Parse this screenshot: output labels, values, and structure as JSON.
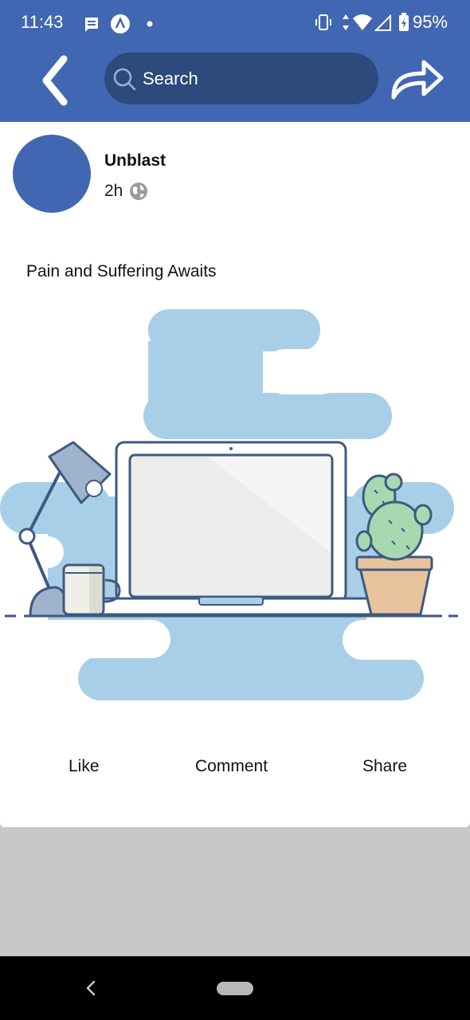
{
  "status_bar": {
    "time": "11:43",
    "battery": "95%",
    "icons": [
      "message-icon",
      "app-icon",
      "dot-icon",
      "vibrate-icon",
      "data-arrows-icon",
      "wifi-icon",
      "signal-icon",
      "battery-icon"
    ]
  },
  "toolbar": {
    "search_placeholder": "Search",
    "back_icon": "chevron-left-icon",
    "share_icon": "share-arrow-icon"
  },
  "post": {
    "author": "Unblast",
    "time": "2h",
    "privacy_icon": "globe-icon",
    "text": "Pain and Suffering Awaits"
  },
  "actions": {
    "like": "Like",
    "comment": "Comment",
    "share": "Share"
  },
  "colors": {
    "brand": "#4267b2",
    "search_bg": "#2c4a7c",
    "page_bg": "#c8c8c8",
    "illustration_blue": "#a9cfe8"
  }
}
